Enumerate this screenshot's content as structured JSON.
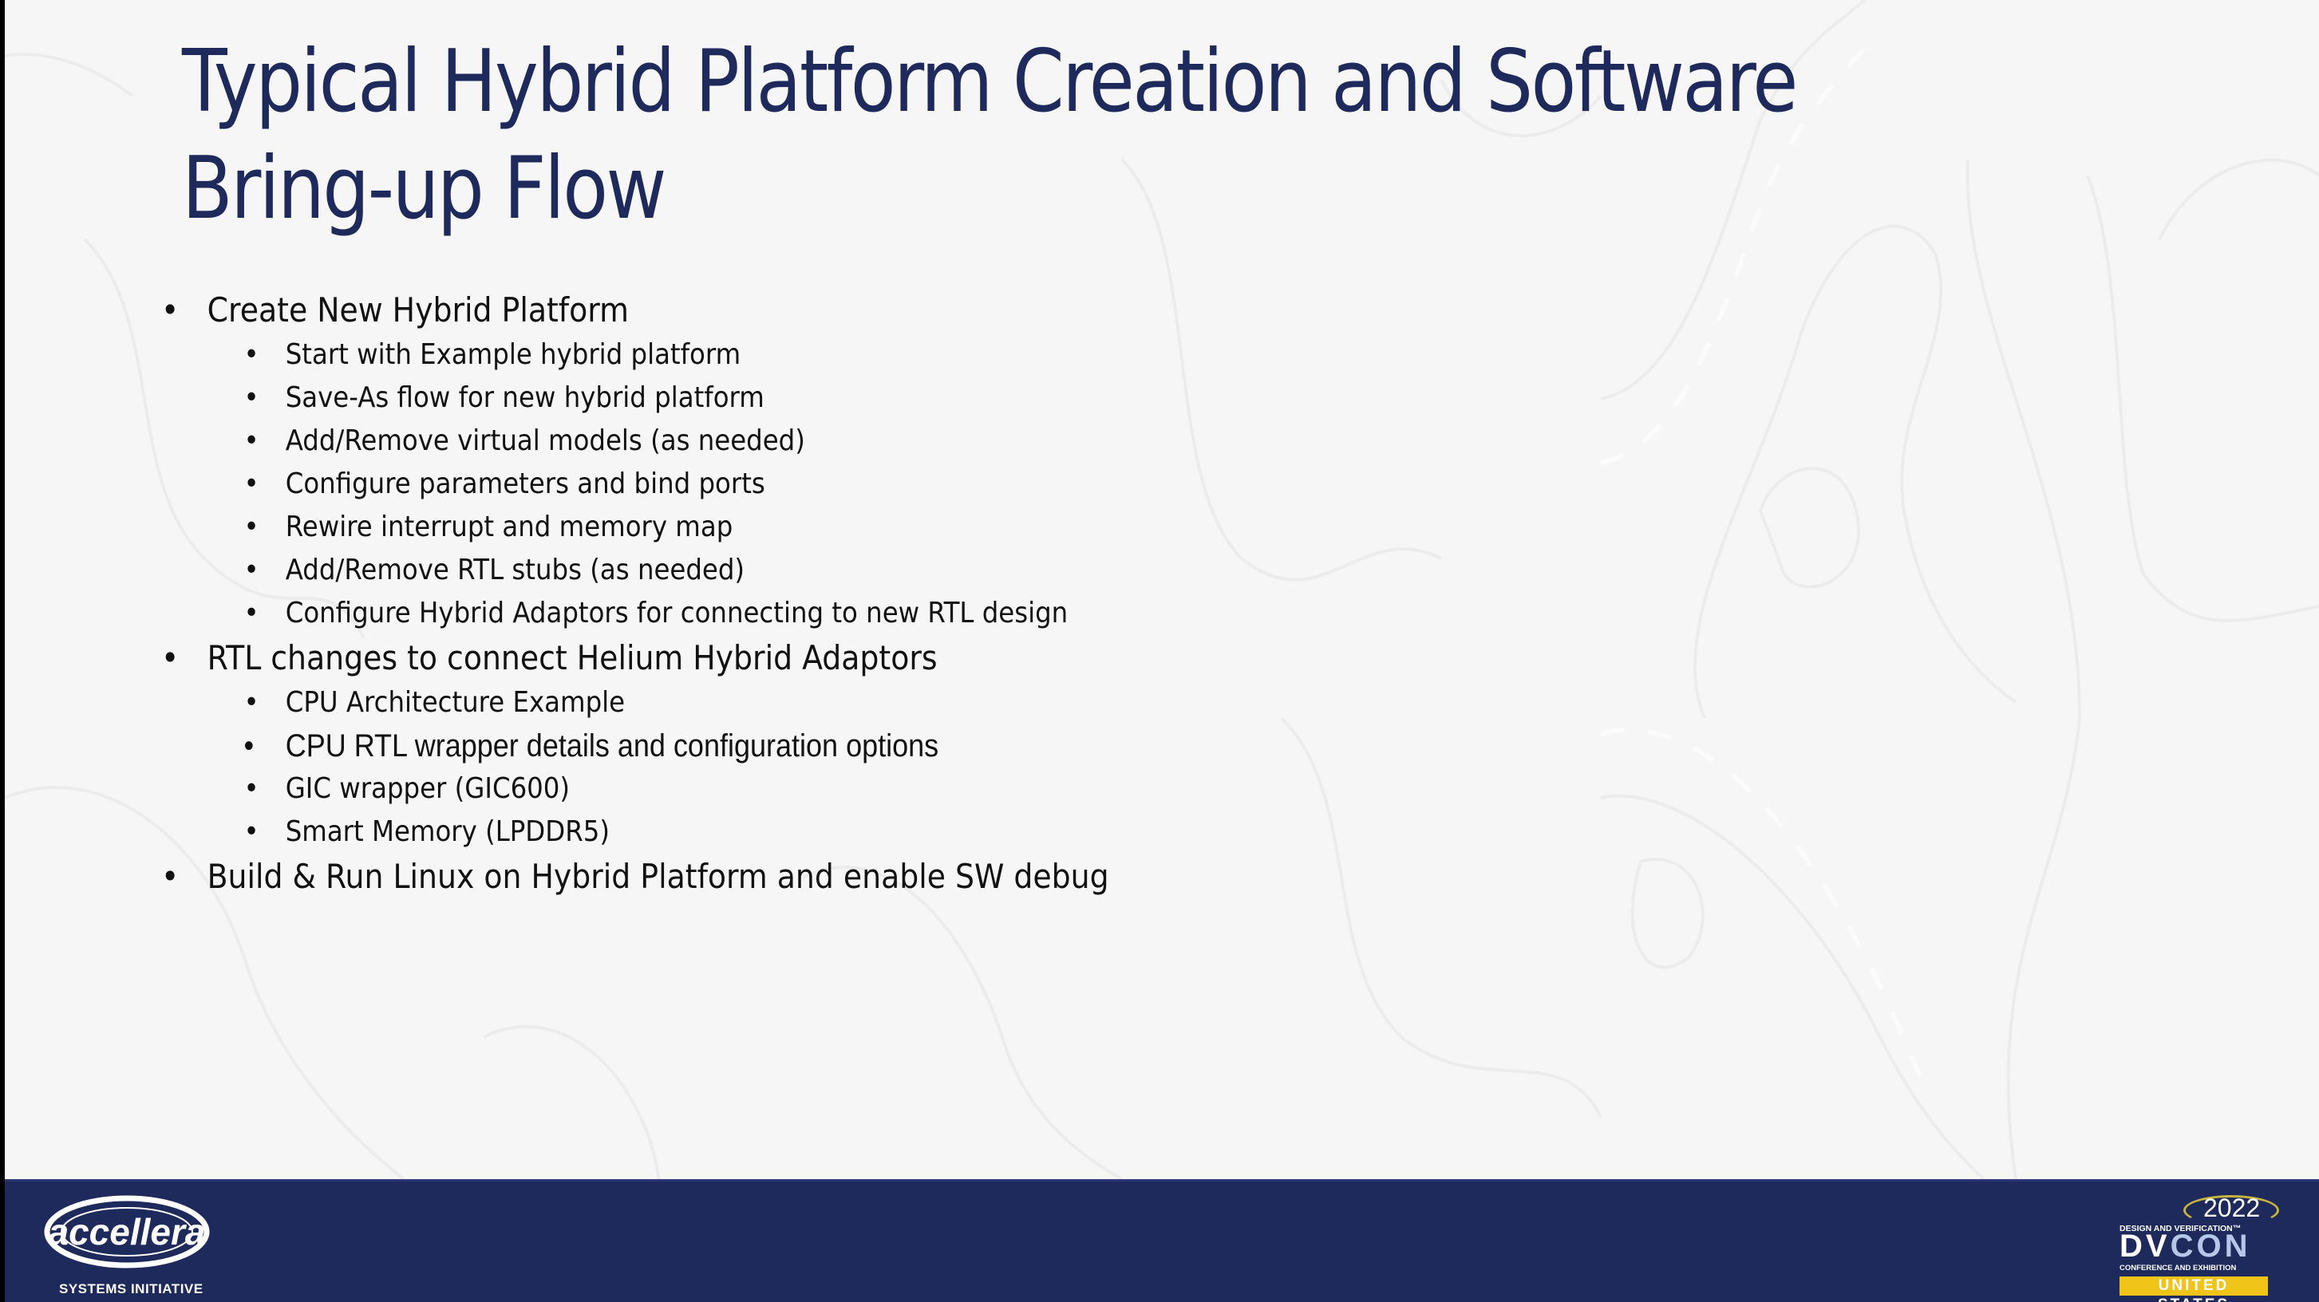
{
  "slide": {
    "title_lines": [
      "Typical Hybrid Platform Creation and Software",
      "Bring-up Flow"
    ],
    "bullet_glyph": "•",
    "sections": [
      {
        "label": "Create New Hybrid Platform",
        "items": [
          "Start with Example hybrid platform",
          "Save-As flow for new hybrid platform",
          "Add/Remove virtual models (as needed)",
          "Configure parameters and bind ports",
          "Rewire interrupt and memory map",
          "Add/Remove RTL stubs (as needed)",
          "Configure Hybrid Adaptors for connecting to new RTL design"
        ]
      },
      {
        "label": "RTL changes to connect Helium Hybrid Adaptors",
        "items": [
          "CPU Architecture Example",
          "CPU RTL wrapper details and configuration options",
          "GIC wrapper (GIC600)",
          "Smart Memory (LPDDR5)"
        ]
      },
      {
        "label": "Build & Run Linux on Hybrid Platform and enable SW debug",
        "items": []
      }
    ]
  },
  "footer": {
    "left_logo": {
      "icon": "accellera-logo-icon",
      "wordmark": "accellera",
      "tagline": "SYSTEMS INITIATIVE"
    },
    "right_logo": {
      "icon": "dvcon-logo-icon",
      "year": "2022",
      "line1": "DESIGN AND VERIFICATION™",
      "main_dv": "DV",
      "main_con": "CON",
      "line2": "CONFERENCE AND EXHIBITION",
      "region": "UNITED STATES"
    }
  },
  "colors": {
    "title": "#1f2a5c",
    "footer_bg": "#1f2a5c",
    "background": "#f6f6f6",
    "dvcon_yellow": "#f0c419",
    "dvcon_light_blue": "#b5c7e8"
  }
}
